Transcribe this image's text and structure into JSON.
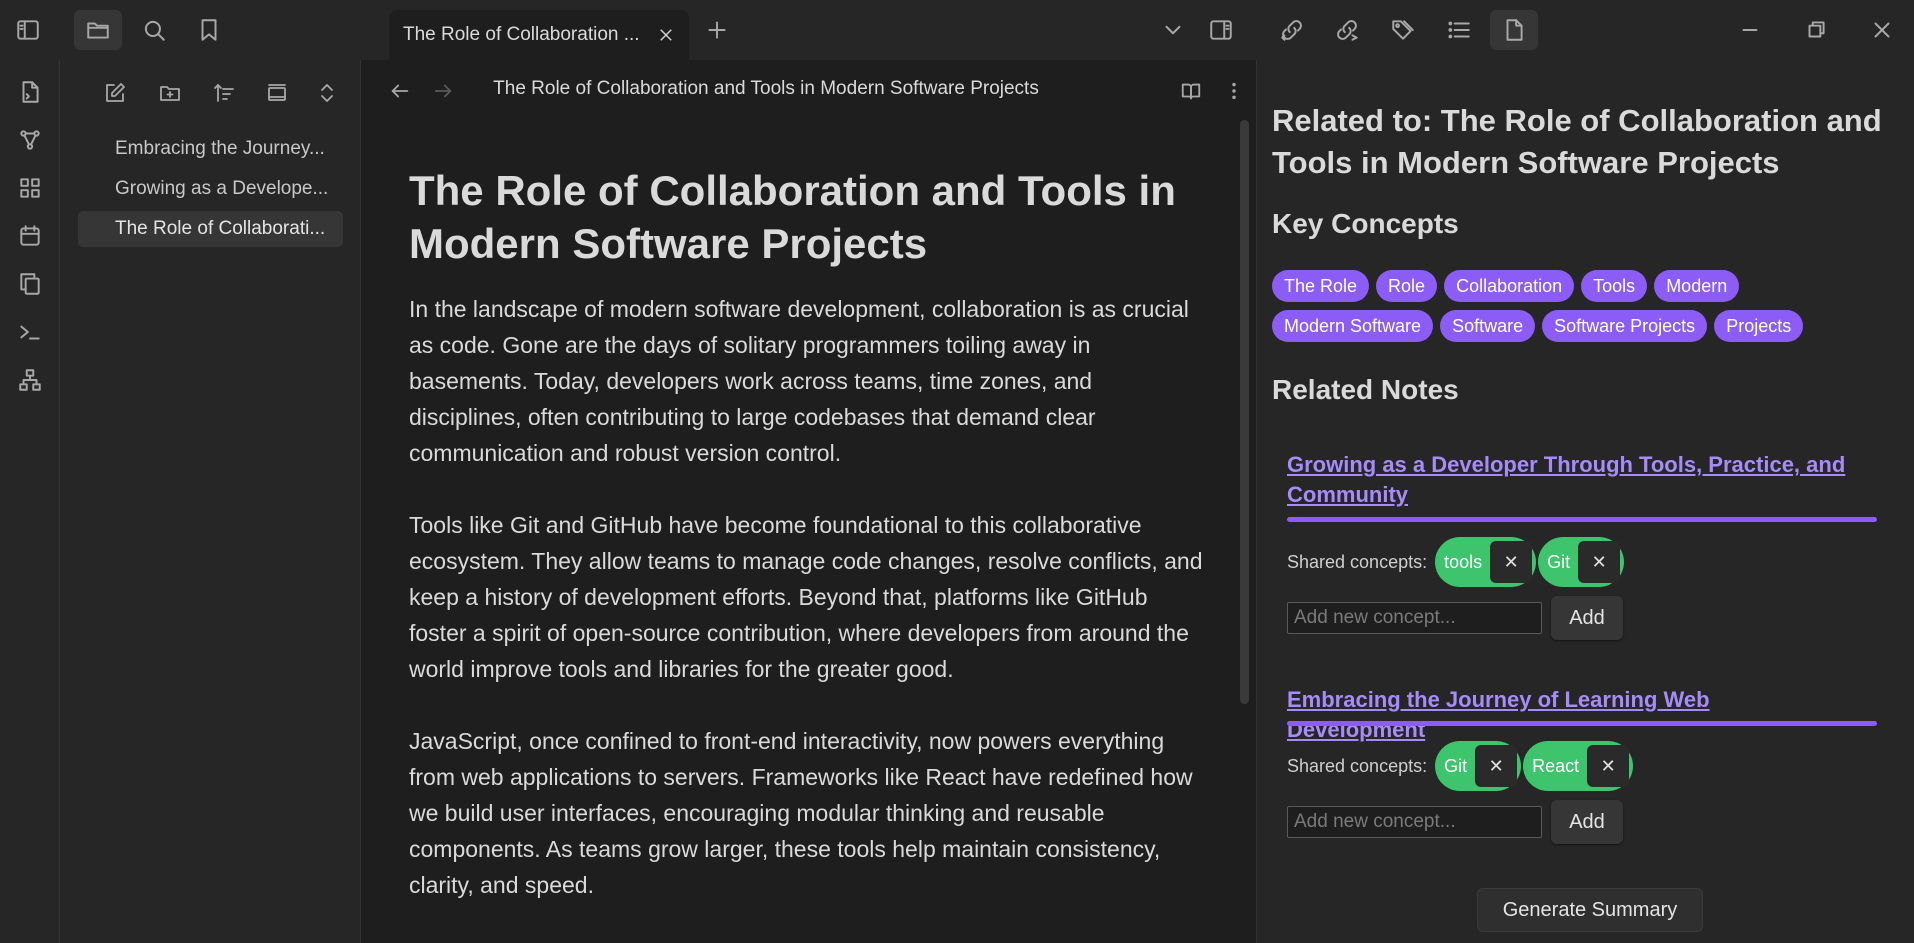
{
  "tab": {
    "title": "The Role of Collaboration ..."
  },
  "explorer": {
    "files": [
      {
        "label": "Embracing the Journey..."
      },
      {
        "label": "Growing as a Develope..."
      },
      {
        "label": "The Role of Collaborati..."
      }
    ]
  },
  "editor": {
    "view_title": "The Role of Collaboration and Tools in Modern Software Projects",
    "heading": "The Role of Collaboration and Tools in Modern Software Projects",
    "paragraphs": [
      "In the landscape of modern software development, collaboration is as crucial as code. Gone are the days of solitary programmers toiling away in basements. Today, developers work across teams, time zones, and disciplines, often contributing to large codebases that demand clear communication and robust version control.",
      "Tools like Git and GitHub have become foundational to this collaborative ecosystem. They allow teams to manage code changes, resolve conflicts, and keep a history of development efforts. Beyond that, platforms like GitHub foster a spirit of open-source contribution, where developers from around the world improve tools and libraries for the greater good.",
      "JavaScript, once confined to front-end interactivity, now powers everything from web applications to servers. Frameworks like React have redefined how we build user interfaces, encouraging modular thinking and reusable components. As teams grow larger, these tools help maintain consistency, clarity, and speed."
    ]
  },
  "related": {
    "title": "Related to: The Role of Collaboration and Tools in Modern Software Projects",
    "key_concepts_heading": "Key Concepts",
    "concepts_row1": [
      "The Role",
      "Role",
      "Collaboration",
      "Tools",
      "Modern"
    ],
    "concepts_row2": [
      "Modern Software",
      "Software",
      "Software Projects",
      "Projects"
    ],
    "related_notes_heading": "Related Notes",
    "notes": [
      {
        "title": "Growing as a Developer Through Tools, Practice, and Community",
        "shared_label": "Shared concepts:",
        "shared": [
          "tools",
          "Git"
        ],
        "input_placeholder": "Add new concept...",
        "add_label": "Add"
      },
      {
        "title": "Embracing the Journey of Learning Web Development",
        "shared_label": "Shared concepts:",
        "shared": [
          "Git",
          "React"
        ],
        "input_placeholder": "Add new concept...",
        "add_label": "Add"
      }
    ],
    "generate_label": "Generate Summary"
  },
  "colors": {
    "accent": "#8b5cf6",
    "chip": "#3ec46d",
    "link": "#a78bfa"
  }
}
